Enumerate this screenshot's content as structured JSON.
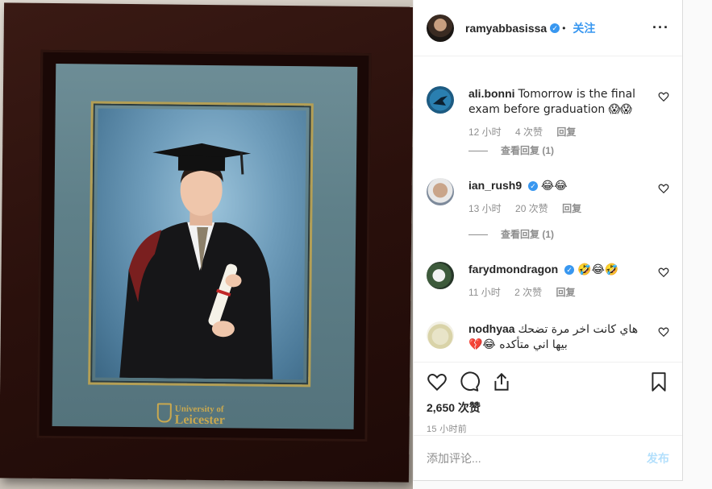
{
  "post": {
    "owner": "ramyabbasissa",
    "follow_label": "关注",
    "more_icon": "more-options-icon",
    "photo_caption": {
      "line1": "University of",
      "line2": "Leicester"
    }
  },
  "comments": [
    {
      "username": "ali.bonni",
      "text": "Tomorrow is the final exam before graduation 😱😱",
      "time": "12 小时",
      "likes": "4 次赞",
      "reply": "回复",
      "view_replies": "查看回复 (1)",
      "verified": false
    },
    {
      "username": "ian_rush9",
      "text": "😂😂",
      "time": "13 小时",
      "likes": "20 次赞",
      "reply": "回复",
      "view_replies": "查看回复 (1)",
      "verified": true
    },
    {
      "username": "farydmondragon",
      "text": "🤣😂🤣",
      "time": "11 小时",
      "likes": "2 次赞",
      "reply": "回复",
      "verified": true
    },
    {
      "username": "nodhyaa",
      "text": "هاي كانت اخر مرة تضحك بيها اني متأكده 😂💔",
      "verified": false
    }
  ],
  "actions": {
    "likes_count": "2,650 次赞",
    "time_ago": "15 小时前",
    "comment_placeholder": "添加评论...",
    "post_label": "发布"
  },
  "colors": {
    "accent": "#3897f0",
    "muted": "#8e8e8e",
    "post_disabled": "#b2dffc"
  }
}
